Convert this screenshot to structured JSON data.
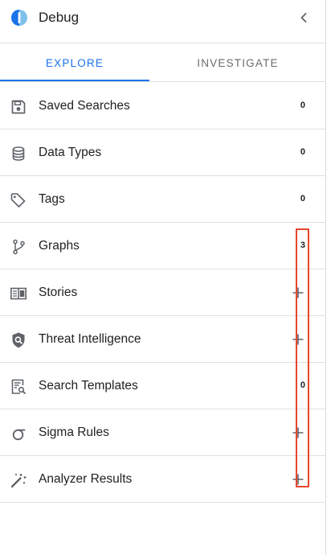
{
  "header": {
    "title": "Debug",
    "logo_icon": "timesketch-logo-icon",
    "collapse_icon": "chevron-left-icon"
  },
  "tabs": [
    {
      "label": "EXPLORE",
      "active": true
    },
    {
      "label": "INVESTIGATE",
      "active": false
    }
  ],
  "items": [
    {
      "label": "Saved Searches",
      "icon": "floppy-disk-icon",
      "count": "0"
    },
    {
      "label": "Data Types",
      "icon": "database-icon",
      "count": "0"
    },
    {
      "label": "Tags",
      "icon": "tag-icon",
      "count": "0"
    },
    {
      "label": "Graphs",
      "icon": "graph-branch-icon",
      "count": "3"
    },
    {
      "label": "Stories",
      "icon": "stories-icon",
      "action": "add"
    },
    {
      "label": "Threat Intelligence",
      "icon": "shield-search-icon",
      "action": "add"
    },
    {
      "label": "Search Templates",
      "icon": "search-template-icon",
      "count": "0"
    },
    {
      "label": "Sigma Rules",
      "icon": "sigma-icon",
      "action": "add"
    },
    {
      "label": "Analyzer Results",
      "icon": "magic-wand-icon",
      "action": "add"
    }
  ],
  "colors": {
    "accent": "#1a73e8",
    "highlight": "#e8452c",
    "icon": "#5f6368",
    "logo_blue": "#1a73e8",
    "logo_light": "#7fc1ec"
  }
}
